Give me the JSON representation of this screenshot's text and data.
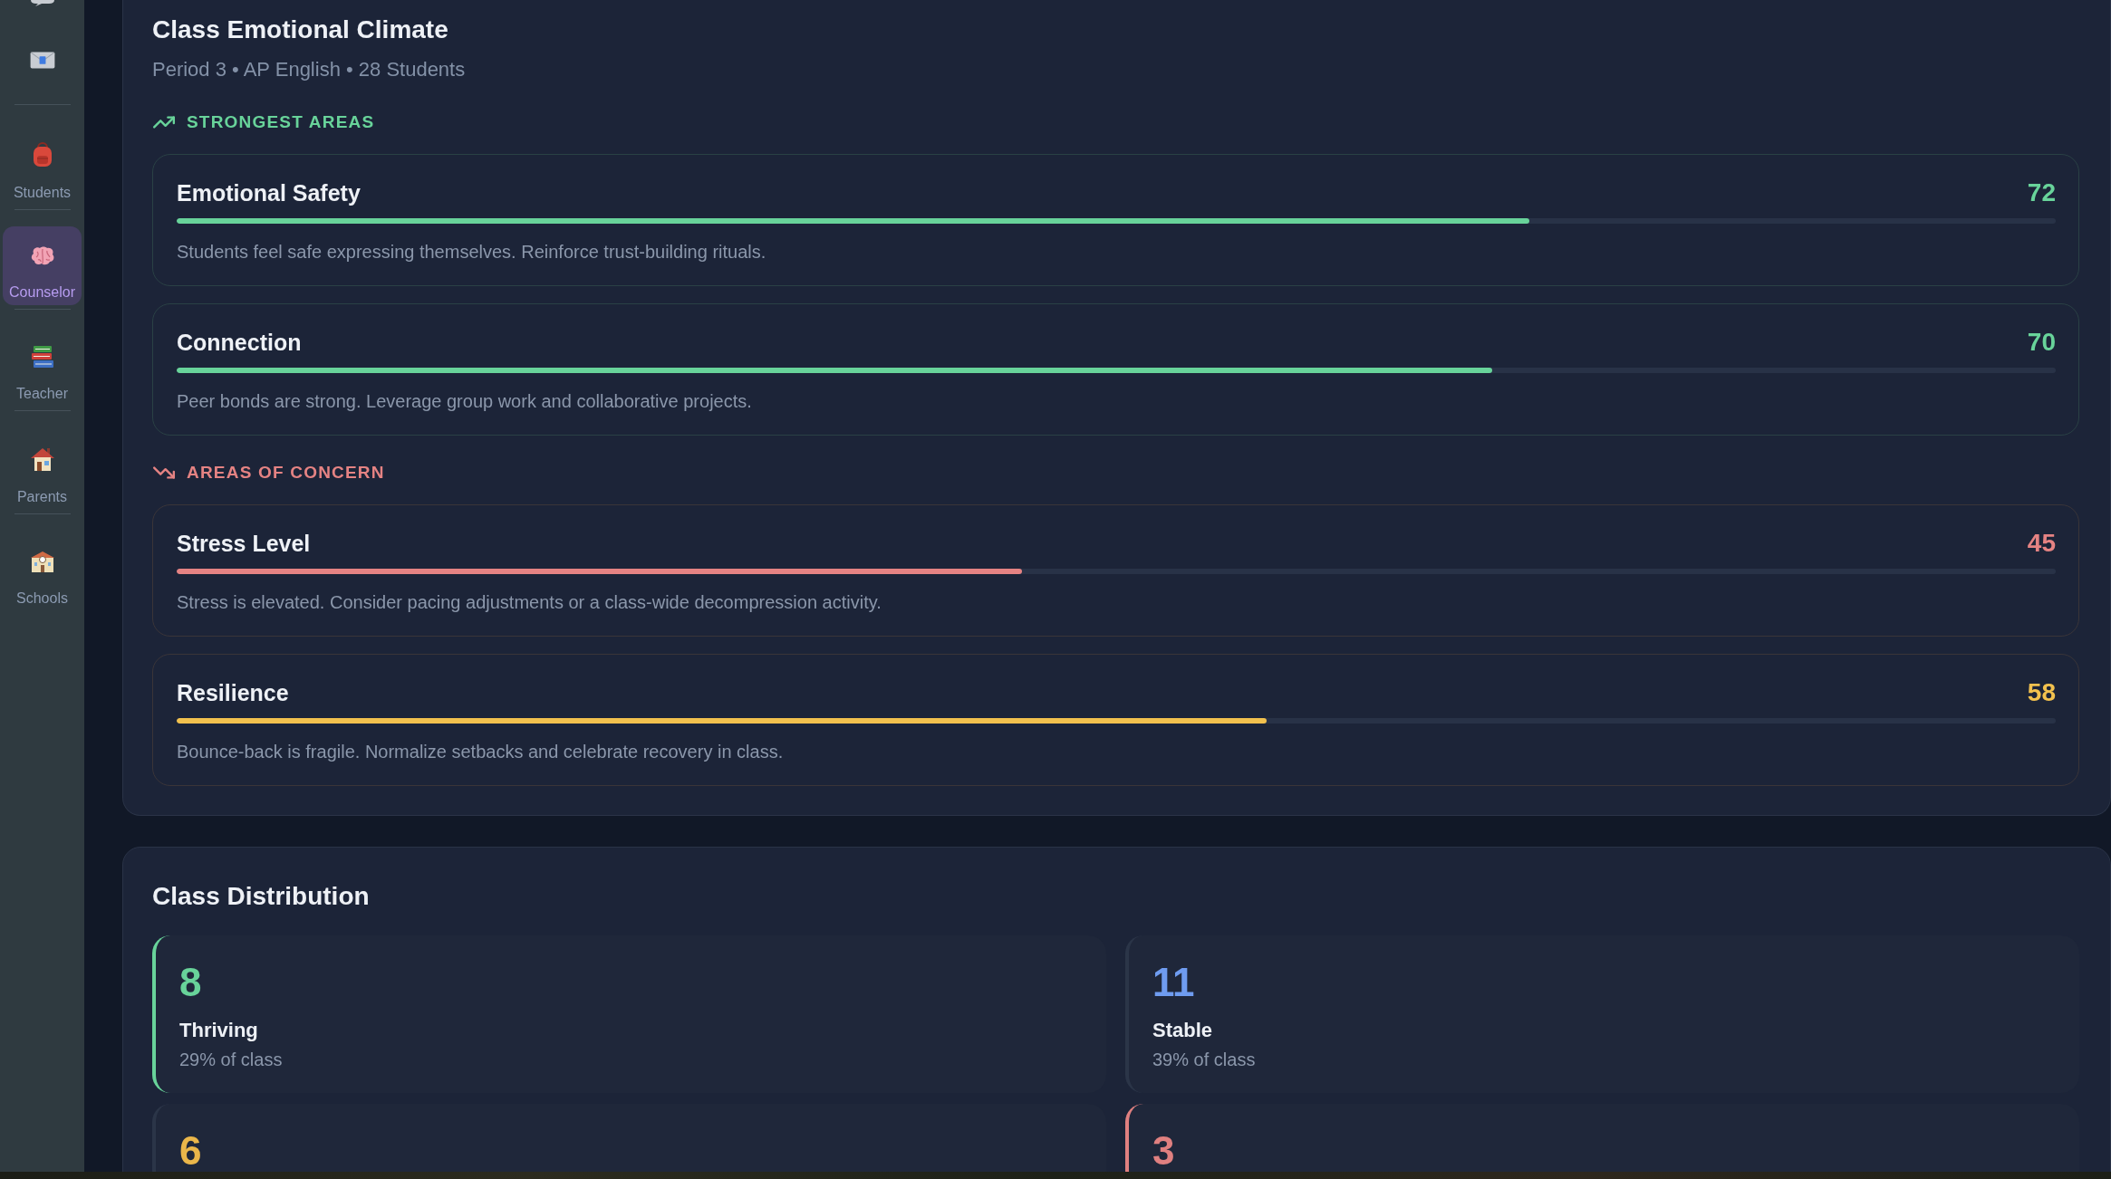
{
  "sidebar": {
    "items": [
      {
        "selected": false
      },
      {
        "label": "Students",
        "selected": false
      },
      {
        "label": "Counselor",
        "selected": true
      },
      {
        "label": "Teacher",
        "selected": false
      },
      {
        "label": "Parents",
        "selected": false
      },
      {
        "label": "Schools",
        "selected": false
      }
    ]
  },
  "climate": {
    "title": "Class Emotional Climate",
    "subtitle": "Period 3 • AP English • 28 Students",
    "groups": [
      {
        "kind": "strong",
        "heading": "STRONGEST AREAS",
        "metrics": [
          {
            "name": "Emotional Safety",
            "score": "72",
            "level": 0.72,
            "color": "#68d39a",
            "description": "Students feel safe expressing themselves. Reinforce trust-building rituals."
          },
          {
            "name": "Connection",
            "score": "70",
            "level": 0.7,
            "color": "#68d39a",
            "description": "Peer bonds are strong. Leverage group work and collaborative projects."
          }
        ]
      },
      {
        "kind": "concern",
        "heading": "AREAS OF CONCERN",
        "metrics": [
          {
            "name": "Stress Level",
            "score": "45",
            "level": 0.45,
            "color": "#e58383",
            "description": "Stress is elevated. Consider pacing adjustments or a class-wide decompression activity."
          },
          {
            "name": "Resilience",
            "score": "58",
            "level": 0.58,
            "color": "#f2c14e",
            "description": "Bounce-back is fragile. Normalize setbacks and celebrate recovery in class."
          }
        ]
      }
    ]
  },
  "distribution": {
    "title": "Class Distribution",
    "cards": [
      {
        "count": "8",
        "label": "Thriving",
        "share": "29% of class",
        "color": "#68d39a",
        "accent": true
      },
      {
        "count": "11",
        "label": "Stable",
        "share": "39% of class",
        "color": "#6f9cf0",
        "accent": false
      },
      {
        "count": "6",
        "color": "#eab64a",
        "accent": false
      },
      {
        "count": "3",
        "color": "#e08080",
        "accent": true
      }
    ]
  }
}
